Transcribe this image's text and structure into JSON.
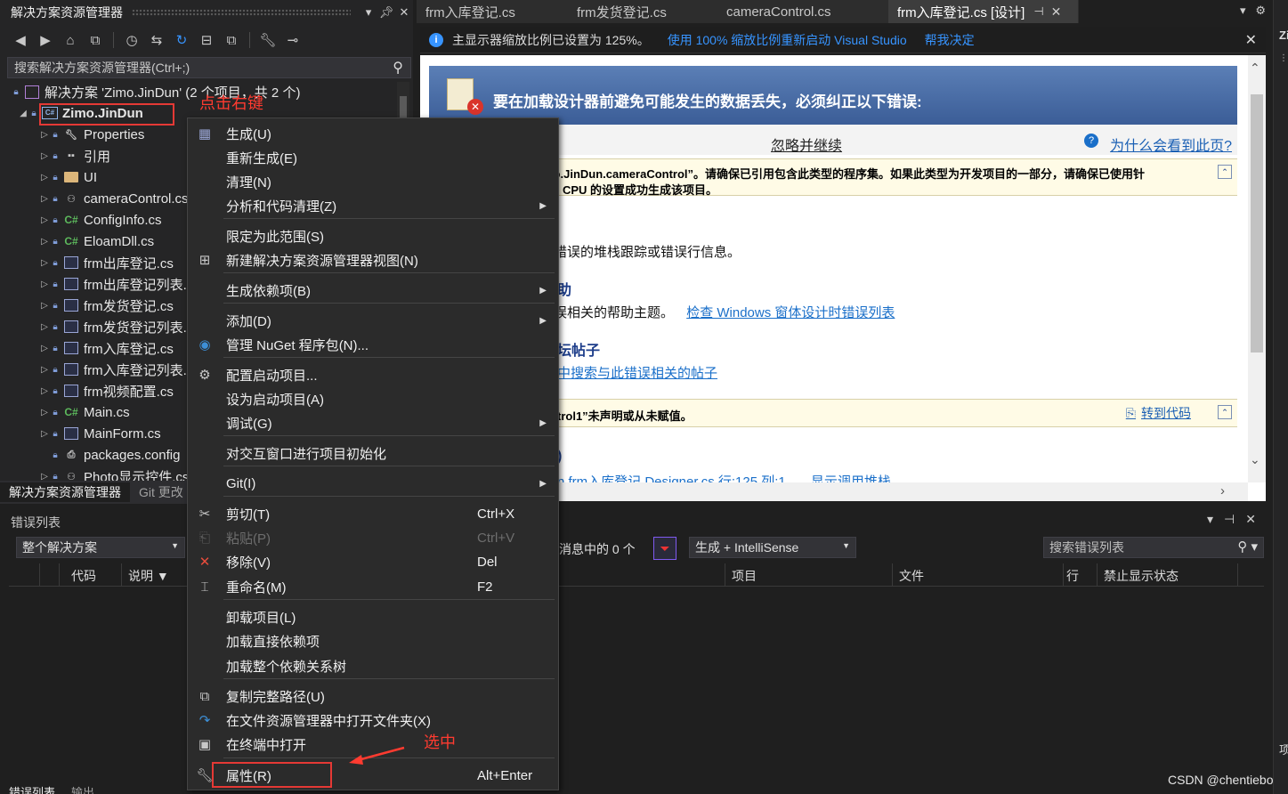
{
  "solution_explorer": {
    "title": "解决方案资源管理器",
    "search_placeholder": "搜索解决方案资源管理器(Ctrl+;)",
    "solution_label": "解决方案 'Zimo.JinDun' (2 个项目，共 2 个)",
    "project_label": "Zimo.JinDun",
    "items": [
      {
        "label": "Properties"
      },
      {
        "label": "引用"
      },
      {
        "label": "UI"
      },
      {
        "label": "cameraControl.cs"
      },
      {
        "label": "ConfigInfo.cs"
      },
      {
        "label": "EloamDll.cs"
      },
      {
        "label": "frm出库登记.cs"
      },
      {
        "label": "frm出库登记列表.cs"
      },
      {
        "label": "frm发货登记.cs"
      },
      {
        "label": "frm发货登记列表.cs"
      },
      {
        "label": "frm入库登记.cs"
      },
      {
        "label": "frm入库登记列表.cs"
      },
      {
        "label": "frm视频配置.cs"
      },
      {
        "label": "Main.cs"
      },
      {
        "label": "MainForm.cs"
      },
      {
        "label": "packages.config"
      },
      {
        "label": "Photo显示控件.cs"
      }
    ],
    "bottom_tabs": [
      "解决方案资源管理器",
      "Git 更改"
    ]
  },
  "annotations": {
    "right_click": "点击右键",
    "select": "选中"
  },
  "doc_tabs": [
    {
      "label": "frm入库登记.cs"
    },
    {
      "label": "frm发货登记.cs"
    },
    {
      "label": "cameraControl.cs"
    },
    {
      "label": "frm入库登记.cs [设计]"
    }
  ],
  "infobar": {
    "message": "主显示器缩放比例已设置为 125%。",
    "link_restart": "使用 100% 缩放比例重新启动 Visual Studio",
    "link_help": "帮我决定"
  },
  "designer_error": {
    "header": "要在加载设计器前避免可能发生的数据丢失，必须纠正以下错误:",
    "ignore": "忽略并继续",
    "why": "为什么会看到此页?",
    "error1": "mo.JinDun.cameraControl”。请确保已引用包含此类型的程序集。如果此类型为开发项目的一部分，请确保已使用针",
    "error1b": "CPU 的设置成功生成该项目。",
    "sec1_h": ")",
    "sec1_t": "错误的堆栈跟踪或错误行信息。",
    "sec2_h": "助",
    "sec2_t": "误相关的帮助主题。",
    "sec2_link": "检查 Windows 窗体设计时错误列表",
    "sec3_h": "坛帖子",
    "sec3_link": "中搜索与此错误相关的帖子",
    "error2": "trol1”未声明或从未赋值。",
    "goto_code": "转到代码",
    "sec4_h": ")",
    "sec4_link": "n frm入库登记.Designer.cs 行:125 列:1",
    "sec4_link2": "显示调用堆栈"
  },
  "error_list": {
    "title": "错误列表",
    "scope": "整个解决方案",
    "messages": "消息中的 0 个",
    "build_filter": "生成 + IntelliSense",
    "search_placeholder": "搜索错误列表",
    "columns": {
      "code": "代码",
      "desc": "说明",
      "project": "项目",
      "file": "文件",
      "line": "行",
      "suppress": "禁止显示状态"
    },
    "bottom_tabs": [
      "错误列表",
      "输出"
    ]
  },
  "context_menu": {
    "items": [
      {
        "label": "生成(U)",
        "icon": "build-icon"
      },
      {
        "label": "重新生成(E)"
      },
      {
        "label": "清理(N)"
      },
      {
        "label": "分析和代码清理(Z)",
        "submenu": true
      },
      {
        "label": "限定为此范围(S)"
      },
      {
        "label": "新建解决方案资源管理器视图(N)",
        "icon": "new-view-icon"
      },
      {
        "label": "生成依赖项(B)",
        "submenu": true
      },
      {
        "label": "添加(D)",
        "submenu": true
      },
      {
        "label": "管理 NuGet 程序包(N)...",
        "icon": "nuget-icon"
      },
      {
        "label": "配置启动项目...",
        "icon": "gear-icon"
      },
      {
        "label": "设为启动项目(A)"
      },
      {
        "label": "调试(G)",
        "submenu": true
      },
      {
        "label": "对交互窗口进行项目初始化"
      },
      {
        "label": "Git(I)",
        "submenu": true
      },
      {
        "label": "剪切(T)",
        "shortcut": "Ctrl+X",
        "icon": "scissors-icon"
      },
      {
        "label": "粘贴(P)",
        "shortcut": "Ctrl+V",
        "icon": "paste-icon",
        "disabled": true
      },
      {
        "label": "移除(V)",
        "shortcut": "Del",
        "icon": "remove-icon"
      },
      {
        "label": "重命名(M)",
        "shortcut": "F2",
        "icon": "rename-icon"
      },
      {
        "label": "卸载项目(L)"
      },
      {
        "label": "加载直接依赖项"
      },
      {
        "label": "加载整个依赖关系树"
      },
      {
        "label": "复制完整路径(U)",
        "icon": "copy-icon"
      },
      {
        "label": "在文件资源管理器中打开文件夹(X)",
        "icon": "open-folder-icon"
      },
      {
        "label": "在终端中打开",
        "icon": "terminal-icon"
      },
      {
        "label": "属性(R)",
        "shortcut": "Alt+Enter",
        "icon": "wrench-icon"
      }
    ]
  },
  "right_strip": {
    "top_label": "Zim",
    "bottom_label": "项"
  },
  "watermark": "CSDN @chentiebo",
  "colors": {
    "accent": "#3794ff",
    "highlight": "#e53935",
    "annotation": "#ff3b30"
  }
}
